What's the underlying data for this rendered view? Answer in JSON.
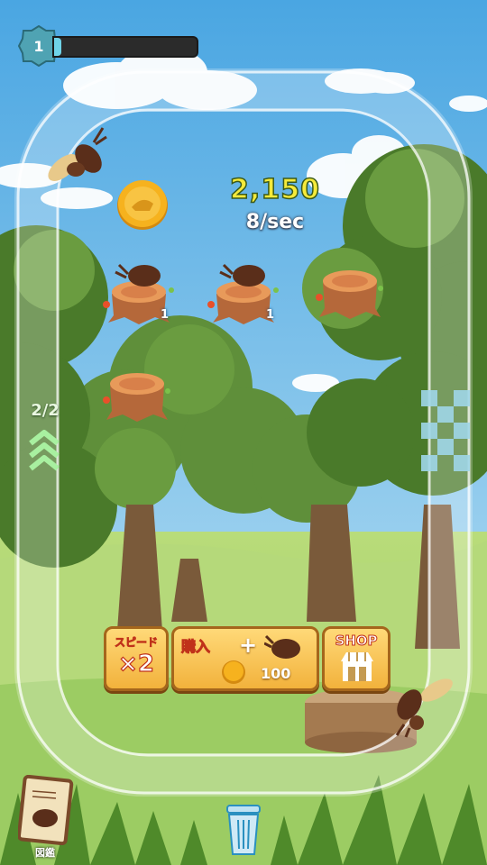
{
  "level": "1",
  "xp_progress": 0.05,
  "score": "2,150",
  "rate": "8/sec",
  "lane_count": "2/2",
  "stumps": [
    {
      "beetle": true,
      "level": "1"
    },
    {
      "beetle": true,
      "level": "1"
    },
    {
      "beetle": false,
      "level": ""
    },
    {
      "beetle": false,
      "level": ""
    }
  ],
  "buttons": {
    "speed_label": "スピード",
    "speed_mult": "×2",
    "buy_label": "購入",
    "buy_plus": "+",
    "buy_price": "100",
    "shop_label": "SHOP"
  },
  "zukan_label": "図鑑",
  "icons": [
    "level-badge-icon",
    "coin-icon",
    "beetle-icon",
    "trash-icon",
    "shop-store-icon",
    "encyclopedia-book-icon",
    "speed-chevrons-icon",
    "finish-flag-icon"
  ],
  "colors": {
    "sky": "#7cc6ef",
    "grass": "#a9d36a",
    "coin": "#f6b21e",
    "score": "#f5ea3a",
    "badge": "#4fa3b3"
  }
}
